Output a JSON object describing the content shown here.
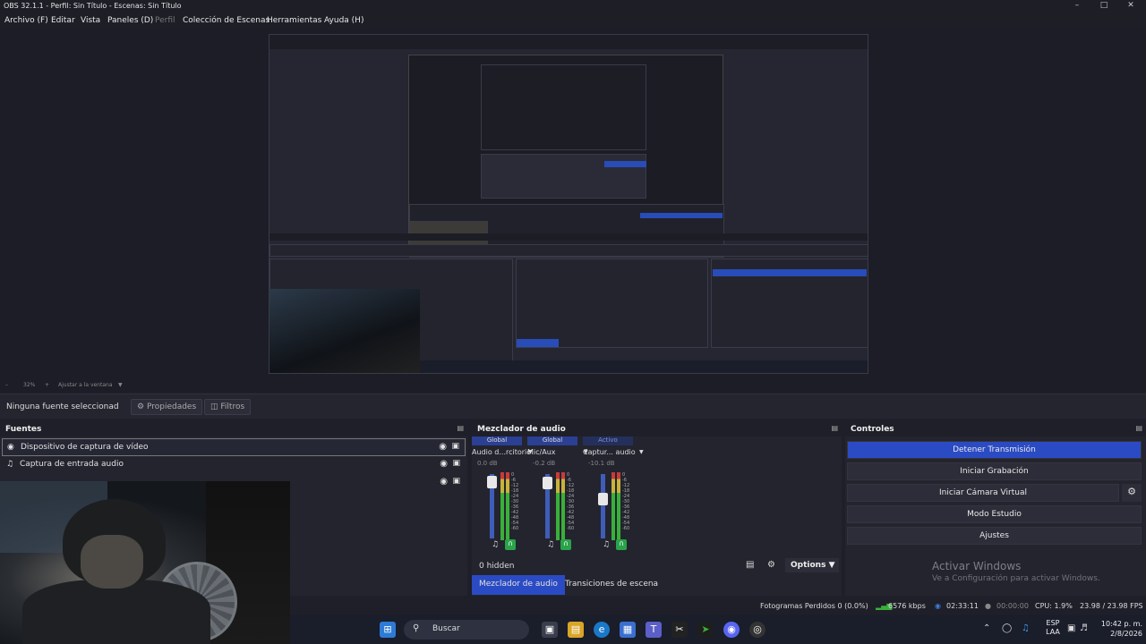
{
  "window": {
    "title": "OBS 32.1.1 - Perfil: Sin Título - Escenas: Sin Título"
  },
  "menu": [
    "Archivo (F)",
    "Editar",
    "Vista",
    "Paneles (D)",
    "Perfil",
    "Colección de Escenas",
    "Herramientas",
    "Ayuda (H)"
  ],
  "preview_zoom": {
    "percent": "32%",
    "fit": "Ajustar a la ventana"
  },
  "source_toolbar": {
    "none_selected": "Ninguna fuente seleccionad",
    "properties": "Propiedades",
    "filters": "Filtros"
  },
  "docks": {
    "sources": "Fuentes",
    "mixer": "Mezclador de audio",
    "controls": "Controles"
  },
  "sources": [
    {
      "name": "Dispositivo de captura de vídeo",
      "icon": "camera-icon"
    },
    {
      "name": "Captura de entrada audio",
      "icon": "mic-icon"
    }
  ],
  "mixer": {
    "channels": [
      {
        "group": "Global",
        "name": "Audio d...rcitorio",
        "db": "0.0 dB",
        "fader": 0.96
      },
      {
        "group": "Global",
        "name": "Mic/Aux",
        "db": "-0.2 dB",
        "fader": 0.95
      },
      {
        "group": "Activo",
        "name": "Captur... audio",
        "db": "-10.1 dB",
        "fader": 0.65
      }
    ],
    "scale": [
      "0",
      "-6",
      "-12",
      "-18",
      "-24",
      "-30",
      "-36",
      "-42",
      "-48",
      "-54",
      "-60"
    ],
    "hidden": "0 hidden",
    "options": "Options",
    "tabs": [
      "Mezclador de audio",
      "Transiciones de escena"
    ]
  },
  "controls": {
    "buttons": [
      "Detener Transmisión",
      "Iniciar Grabación",
      "Iniciar Cámara Virtual",
      "Modo Estudio",
      "Ajustes"
    ]
  },
  "watermark": {
    "line1": "Activar Windows",
    "line2": "Ve a Configuración para activar Windows."
  },
  "status": {
    "dropped": "Fotogramas Perdidos 0 (0.0%)",
    "bitrate": "6576 kbps",
    "stream_time": "02:33:11",
    "rec_time": "00:00:00",
    "cpu": "CPU: 1.9%",
    "fps": "23.98 / 23.98 FPS"
  },
  "taskbar": {
    "search": "Buscar",
    "lang1": "ESP",
    "lang2": "LAA",
    "time": "10:42 p. m.",
    "date": "2/8/2026"
  },
  "colors": {
    "accent": "#2b4bc4",
    "meter_green": "#3ab03a",
    "background": "#1e1f29"
  }
}
